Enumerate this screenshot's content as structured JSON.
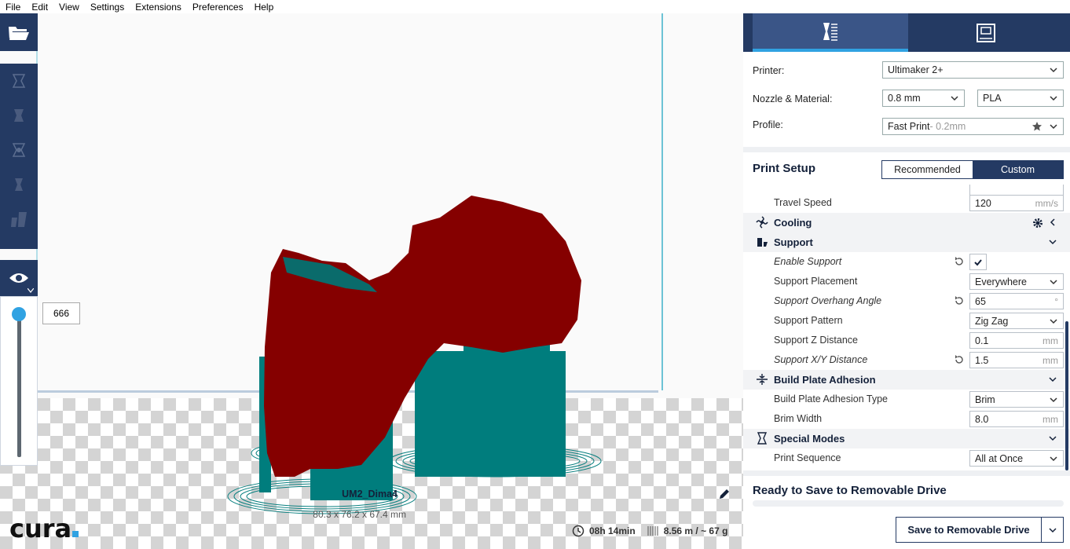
{
  "menu": [
    "File",
    "Edit",
    "View",
    "Settings",
    "Extensions",
    "Preferences",
    "Help"
  ],
  "layer_value": "666",
  "model": {
    "name": "UM2_Dima4",
    "dimensions": "80.3 x 76.2 x 67.4 mm",
    "time": "08h 14min",
    "material_usage": "8.56 m / ~ 67 g"
  },
  "logo": "cura",
  "printer": {
    "printer_label": "Printer:",
    "printer_value": "Ultimaker 2+",
    "nozzle_label": "Nozzle & Material:",
    "nozzle_value": "0.8 mm",
    "material_value": "PLA",
    "profile_label": "Profile:",
    "profile_value": "Fast Print",
    "profile_suffix": " - 0.2mm"
  },
  "setup": {
    "title": "Print Setup",
    "recommended": "Recommended",
    "custom": "Custom"
  },
  "settings": {
    "travel_speed": {
      "label": "Travel Speed",
      "value": "120",
      "unit": "mm/s"
    },
    "cooling": "Cooling",
    "support": "Support",
    "enable_support": {
      "label": "Enable Support"
    },
    "support_placement": {
      "label": "Support Placement",
      "value": "Everywhere"
    },
    "overhang_angle": {
      "label": "Support Overhang Angle",
      "value": "65",
      "unit": "°"
    },
    "support_pattern": {
      "label": "Support Pattern",
      "value": "Zig Zag"
    },
    "support_z": {
      "label": "Support Z Distance",
      "value": "0.1",
      "unit": "mm"
    },
    "support_xy": {
      "label": "Support X/Y Distance",
      "value": "1.5",
      "unit": "mm"
    },
    "adhesion": "Build Plate Adhesion",
    "adhesion_type": {
      "label": "Build Plate Adhesion Type",
      "value": "Brim"
    },
    "brim_width": {
      "label": "Brim Width",
      "value": "8.0",
      "unit": "mm"
    },
    "special": "Special Modes",
    "print_sequence": {
      "label": "Print Sequence",
      "value": "All at Once"
    }
  },
  "status": {
    "ready": "Ready to Save to Removable Drive",
    "save_button": "Save to Removable Drive"
  },
  "colors": {
    "accent": "#30a2e2",
    "navy": "#243a63",
    "model_red": "#850000",
    "support_teal": "#007d7d"
  }
}
